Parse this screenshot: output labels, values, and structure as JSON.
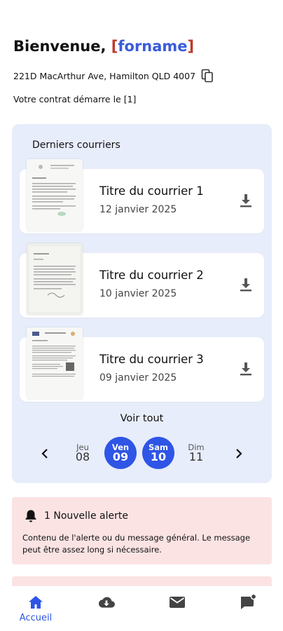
{
  "header": {
    "greeting": "Bienvenue,",
    "name_open": "[",
    "name": "forname",
    "name_close": "]",
    "address": "221D MacArthur Ave, Hamilton QLD 4007",
    "contract_text": "Votre contrat démarre le [1]"
  },
  "mail": {
    "section_title": "Derniers courriers",
    "items": [
      {
        "title": "Titre du courrier 1",
        "date": "12 janvier 2025"
      },
      {
        "title": "Titre du courrier 2",
        "date": "10 janvier 2025"
      },
      {
        "title": "Titre du courrier 3",
        "date": "09 janvier 2025"
      }
    ],
    "see_all_label": "Voir tout"
  },
  "days": [
    {
      "name": "Jeu",
      "num": "08",
      "selected": false
    },
    {
      "name": "Ven",
      "num": "09",
      "selected": true
    },
    {
      "name": "Sam",
      "num": "10",
      "selected": true
    },
    {
      "name": "Dim",
      "num": "11",
      "selected": false
    }
  ],
  "alert": {
    "title": "1 Nouvelle alerte",
    "body": "Contenu de l'alerte ou du message général. Le message peut être assez long si nécessaire."
  },
  "nav": {
    "home_label": "Accueil",
    "icons": [
      "home-icon",
      "cloud-download-icon",
      "mail-icon",
      "message-notification-icon"
    ]
  },
  "colors": {
    "accent": "#2f55e6",
    "panel_bg": "#e8edfb",
    "alert_bg": "#fbe3e4",
    "name_bracket": "#c0392b",
    "name_text": "#3b5bdb"
  }
}
